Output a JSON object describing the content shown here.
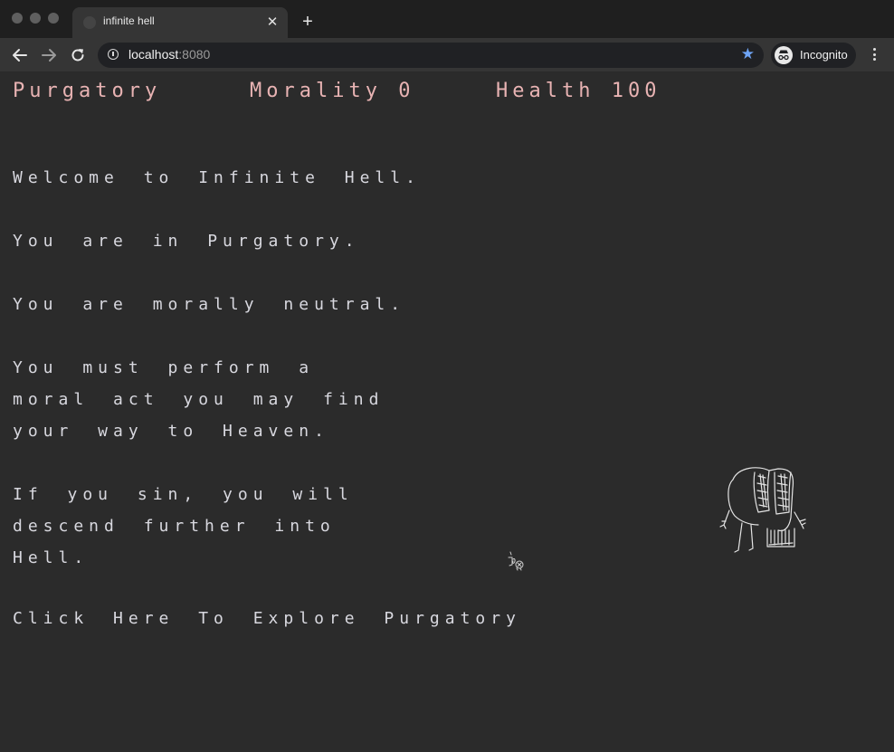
{
  "browser": {
    "tab_title": "infinite hell",
    "url_host": "localhost",
    "url_port": ":8080",
    "incognito_label": "Incognito",
    "accent_color": "#6ea4f5"
  },
  "hud": {
    "location": "Purgatory",
    "morality": "Morality 0",
    "health": "Health 100",
    "color": "#e8b3b3"
  },
  "story": {
    "welcome": "Welcome to Infinite Hell.",
    "location_line": "You are in Purgatory.",
    "morality_line": "You are morally neutral.",
    "heaven_lines": [
      "You must perform a",
      "moral act you may find",
      "your way to Heaven."
    ],
    "sin_lines": [
      "If you sin, you will",
      "descend further into",
      "Hell."
    ],
    "explore_link": "Click Here To Explore Purgatory"
  },
  "icons": {
    "back": "arrow-left-icon",
    "forward": "arrow-right-icon",
    "reload": "reload-icon",
    "info": "info-icon",
    "bookmark": "star-icon",
    "incognito": "incognito-icon",
    "menu": "kebab-menu-icon"
  }
}
